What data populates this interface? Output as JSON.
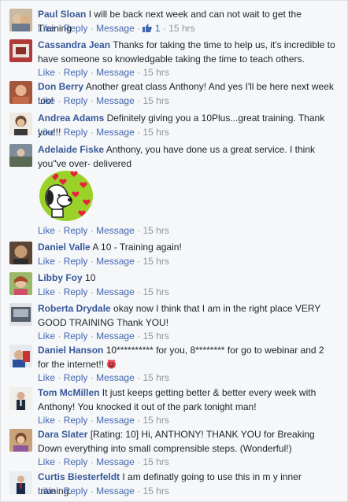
{
  "actions": {
    "like": "Like",
    "reply": "Reply",
    "message": "Message",
    "dot": "·"
  },
  "comments": [
    {
      "author": "Paul Sloan",
      "text": "I will be back next week and can not wait to get the Training",
      "time": "15 hrs",
      "likes": "1"
    },
    {
      "author": "Cassandra Jean",
      "text": "Thanks for taking the time to help us, it's incredible to have someone so knowledgable taking the time to teach others.",
      "time": "15 hrs"
    },
    {
      "author": "Don Berry",
      "text": "Another great class Anthony! And yes I'll be here next week too!",
      "time": "15 hrs"
    },
    {
      "author": "Andrea Adams",
      "text": "Definitely giving you a 10Plus...great training. Thank you!!!",
      "time": "15 hrs"
    },
    {
      "author": "Adelaide Fiske",
      "text": "Anthony, you have done us a great service. I think you\"ve over- delivered",
      "time": "15 hrs"
    },
    {
      "author": "Daniel Valle",
      "text": "A 10 - Training again!",
      "time": "15 hrs"
    },
    {
      "author": "Libby Foy",
      "text": "10",
      "time": "15 hrs"
    },
    {
      "author": "Roberta Drydale",
      "text": "okay now I think that I am in the right place VERY GOOD TRAINING Thank YOU!",
      "time": "15 hrs"
    },
    {
      "author": "Daniel Hanson",
      "text": "10********** for you, 8******** for go to webinar and 2 for the internet!!",
      "time": "15 hrs"
    },
    {
      "author": "Tom McMillen",
      "text": "It just keeps getting better & better every week with Anthony! You knocked it out of the park tonight man!",
      "time": "15 hrs"
    },
    {
      "author": "Dara Slater",
      "text": "[Rating: 10] Hi, ANTHONY! THANK YOU for Breaking Down everything into small comprensible steps. (Wonderful!)",
      "time": "15 hrs"
    },
    {
      "author": "Curtis Biesterfeldt",
      "text": "I am definatly going to use this in m y inner training.",
      "time": "15 hrs"
    }
  ]
}
